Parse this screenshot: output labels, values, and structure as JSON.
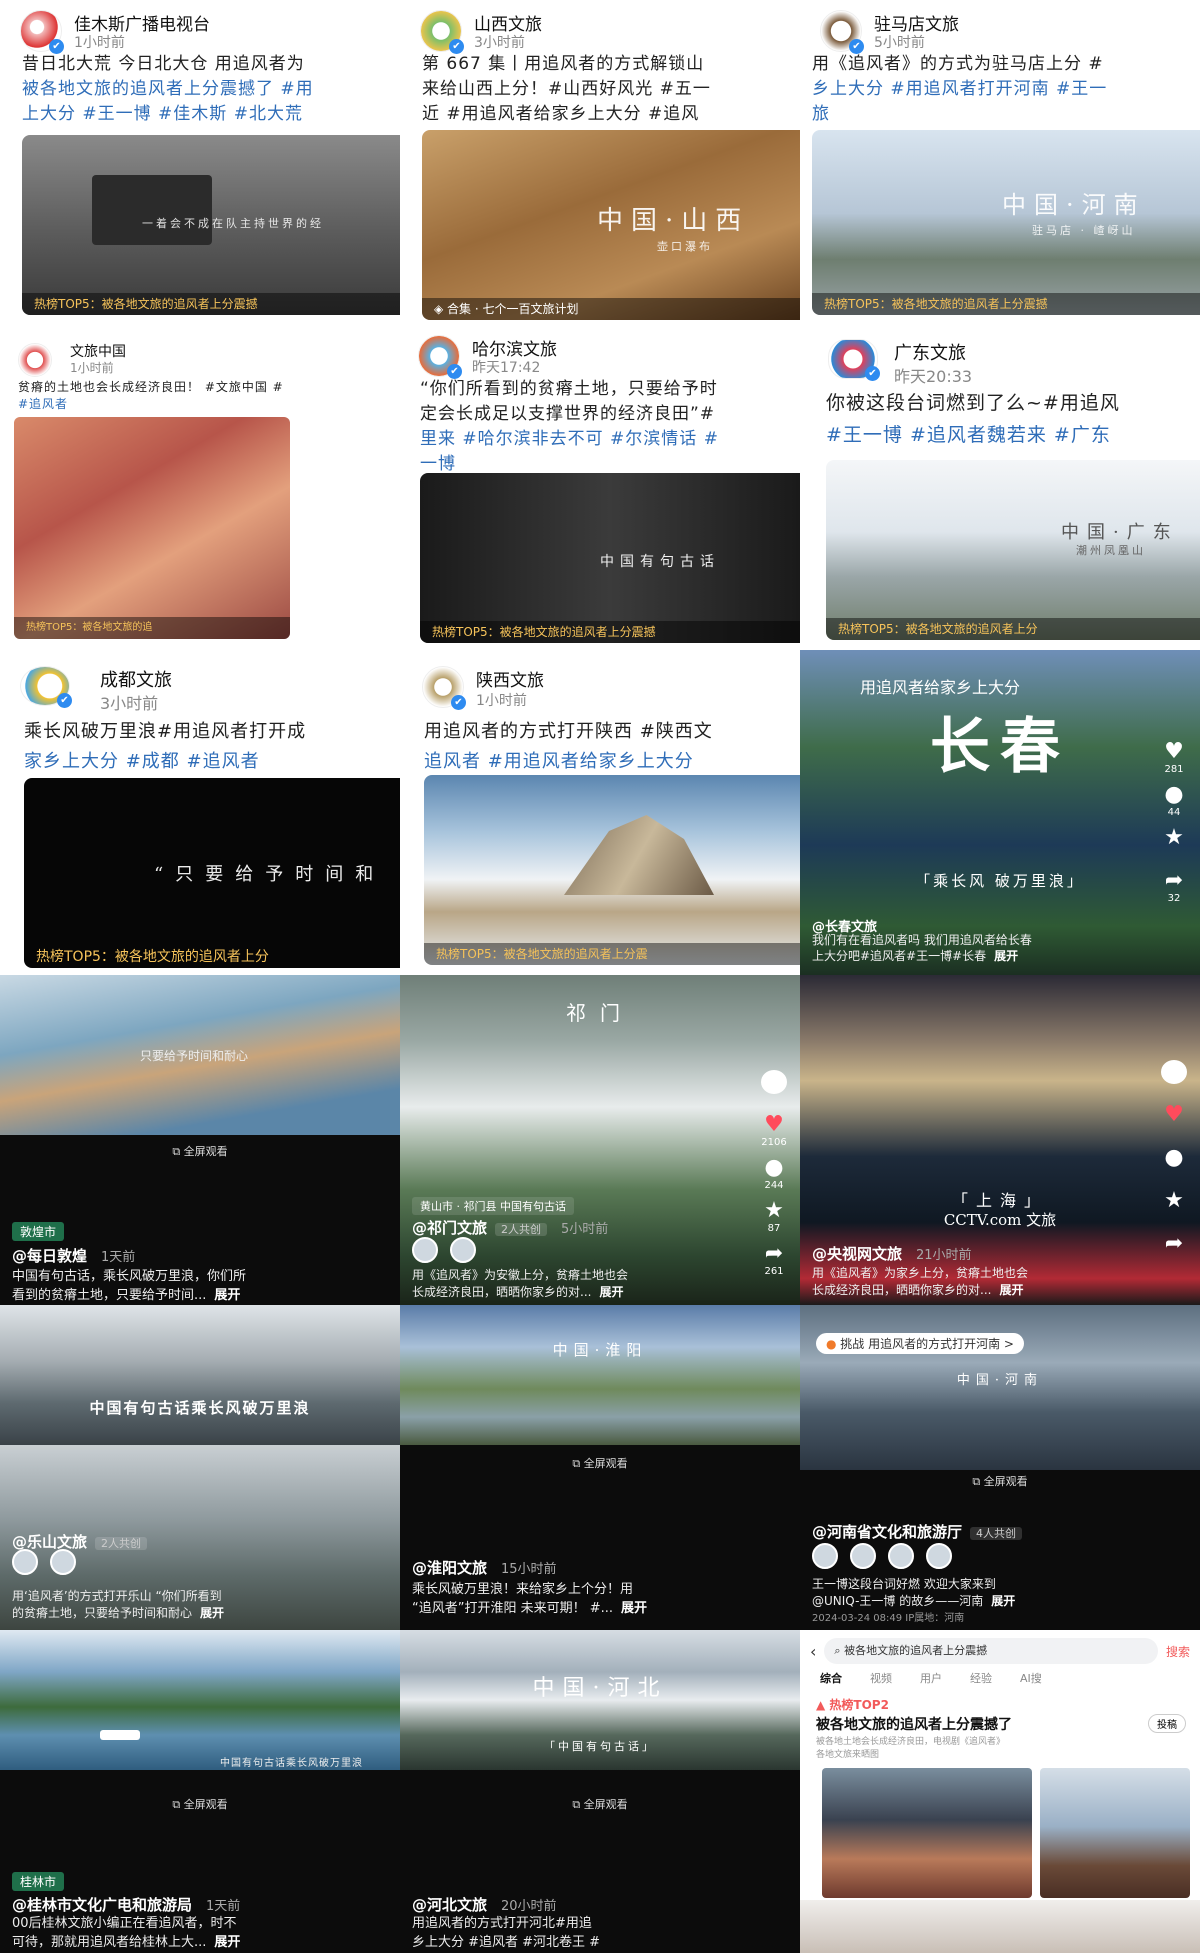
{
  "posts": [
    {
      "name": "佳木斯广播电视台",
      "time": "1小时前",
      "line1": "昔日北大荒 今日北大仓 用追风者为",
      "line2": "被各地文旅的追风者上分震撼了 #用",
      "line3": "上大分 #王一博 #佳木斯 #北大荒",
      "overlay": "一着会不成在队主持世界的经",
      "bar": "热榜TOP5：被各地文旅的追风者上分震撼"
    },
    {
      "name": "山西文旅",
      "time": "3小时前",
      "line1": "第 667 集丨用追风者的方式解锁山",
      "line2": "来给山西上分！#山西好风光 #五一",
      "line3": "近 #用追风者给家乡上大分 #追风",
      "caption": "中国·山西",
      "subcaption": "壶口瀑布",
      "bar": "合集 · 七个一百文旅计划"
    },
    {
      "name": "驻马店文旅",
      "time": "5小时前",
      "line1": "用《追风者》的方式为驻马店上分 #",
      "line2": "乡上大分 #用追风者打开河南 #王一",
      "line3": "旅",
      "caption": "中国·河南",
      "subcaption": "驻马店 · 嵖岈山",
      "bar": "热榜TOP5：被各地文旅的追风者上分震撼"
    },
    {
      "name": "文旅中国",
      "time": "1小时前",
      "line1": "贫瘠的土地也会长成经济良田！ #文旅中国 #",
      "line2": "#追风者",
      "bar": "热榜TOP5：被各地文旅的追"
    },
    {
      "name": "哈尔滨文旅",
      "time": "昨天17:42",
      "line1": "“你们所看到的贫瘠土地，只要给予时",
      "line2": "定会长成足以支撑世界的经济良田”#",
      "line3": "里来 #哈尔滨非去不可 #尔滨情话 #",
      "line4": "一博",
      "caption": "中国有句古话",
      "bar": "热榜TOP5：被各地文旅的追风者上分震撼"
    },
    {
      "name": "广东文旅",
      "time": "昨天20:33",
      "line1": "你被这段台词燃到了么~#用追风",
      "line2": "#王一博 #追风者魏若来 #广东",
      "caption": "中国·广东",
      "subcaption": "潮州凤凰山",
      "bar": "热榜TOP5：被各地文旅的追风者上分"
    },
    {
      "name": "成都文旅",
      "time": "3小时前",
      "line1": "乘长风破万里浪#用追风者打开成",
      "line2": "家乡上大分 #成都 #追风者",
      "caption": "“只要给予时间和",
      "bar": "热榜TOP5：被各地文旅的追风者上分"
    },
    {
      "name": "陕西文旅",
      "time": "1小时前",
      "line1": "用追风者的方式打开陕西 #陕西文",
      "line2": "追风者 #用追风者给家乡上大分",
      "bar": "热榜TOP5：被各地文旅的追风者上分震"
    }
  ],
  "changchun": {
    "top": "用追风者给家乡上大分",
    "city": "长春",
    "sub": "「乘长风  破万里浪」",
    "author": "@长春文旅",
    "desc1": "我们有在看追风者吗 我们用追风者给长春",
    "desc2": "上大分吧#追风者#王一博#长春",
    "more": "展开",
    "likes": "281",
    "comments": "44",
    "shares": "32"
  },
  "videos": [
    {
      "loc": "敦煌市",
      "author": "@每日敦煌",
      "when": "1天前",
      "overlay": "只要给予时间和耐心",
      "fullscreen": "全屏观看",
      "desc1": "中国有句古话，乘长风破万里浪，你们所",
      "desc2": "看到的贫瘠土地，只要给予时间...",
      "more": "展开"
    },
    {
      "loc": "黄山市 · 祁门县  中国有句古话",
      "author": "@祁门文旅",
      "co": "2人共创",
      "when": "5小时前",
      "title": "祁门",
      "desc1": "用《追风者》为安徽上分，贫瘠土地也会",
      "desc2": "长成经济良田，晒晒你家乡的对...",
      "more": "展开",
      "likes": "2106",
      "comments": "244",
      "stars": "87",
      "shares": "261"
    },
    {
      "author": "@央视网文旅",
      "when": "21小时前",
      "caption": "「上海」",
      "logo": "CCTV.com 文旅",
      "desc1": "用《追风者》为家乡上分，贫瘠土地也会",
      "desc2": "长成经济良田，晒晒你家乡的对...",
      "more": "展开"
    },
    {
      "overlay": "中国有句古话乘长风破万里浪",
      "author": "@乐山文旅",
      "co": "2人共创",
      "desc1": "用‘追风者’的方式打开乐山 “你们所看到",
      "desc2": "的贫瘠土地，只要给予时间和耐心",
      "more": "展开"
    },
    {
      "caption": "中国·淮阳",
      "fullscreen": "全屏观看",
      "author": "@淮阳文旅",
      "when": "15小时前",
      "desc1": "乘长风破万里浪！来给家乡上个分！用",
      "desc2": "“追风者”打开淮阳 未来可期！ #...",
      "more": "展开"
    },
    {
      "challenge": "挑战 用追风者的方式打开河南 >",
      "caption": "中国·河南",
      "fullscreen": "全屏观看",
      "author": "@河南省文化和旅游厅",
      "co": "4人共创",
      "desc1": "王一博这段台词好燃 欢迎大家来到",
      "desc2": "@UNIQ-王一博 的故乡——河南",
      "more": "展开",
      "date": "2024-03-24 08:49  IP属地：河南"
    },
    {
      "loc": "桂林市",
      "author": "@桂林市文化广电和旅游局",
      "when": "1天前",
      "overlay": "中国有句古话乘长风破万里浪",
      "fullscreen": "全屏观看",
      "desc1": "00后桂林文旅小编正在看追风者，时不",
      "desc2": "可待，那就用追风者给桂林上大...",
      "more": "展开"
    },
    {
      "caption": "中国·河北",
      "sub": "「中国有句古话」",
      "fullscreen": "全屏观看",
      "author": "@河北文旅",
      "when": "20小时前",
      "desc1": "用追风者的方式打开河北#用追",
      "desc2": "乡上大分 #追风者 #河北卷王 #"
    }
  ],
  "search": {
    "query": "被各地文旅的追风者上分震撼",
    "button": "搜索",
    "tabs": [
      "综合",
      "视频",
      "用户",
      "经验",
      "AI搜"
    ],
    "hot": "热榜TOP2",
    "title": "被各地文旅的追风者上分震撼了",
    "vote": "投稿",
    "snippet1": "被各地土地会长成经济良田，电视剧《追风者》",
    "snippet2": "各地文旅来晒图"
  }
}
